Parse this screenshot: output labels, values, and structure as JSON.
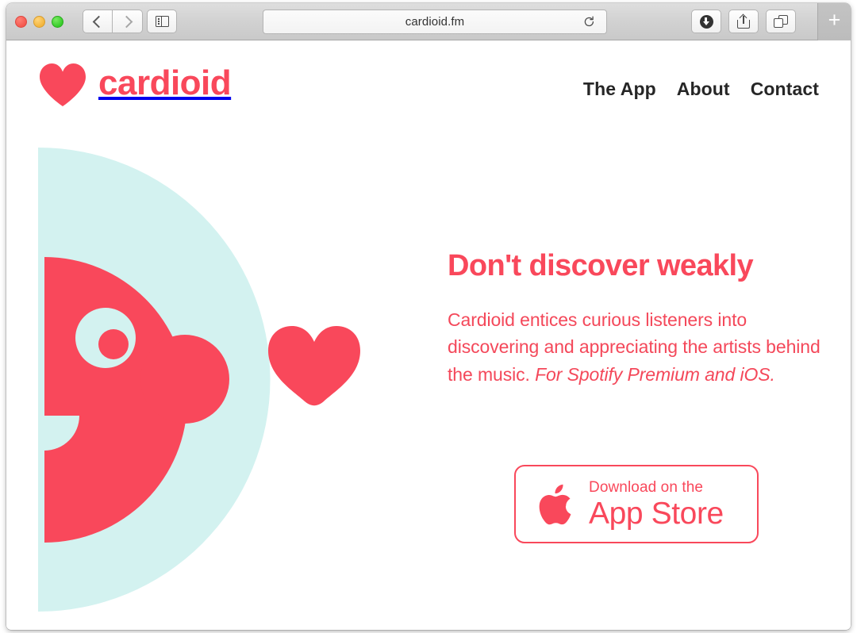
{
  "browser": {
    "window_controls": [
      "close",
      "minimize",
      "maximize"
    ],
    "back_label": "Back",
    "forward_label": "Forward",
    "sidebar_label": "Show Sidebar",
    "url": "cardioid.fm",
    "reload_label": "Reload",
    "downloads_label": "Downloads",
    "share_label": "Share",
    "tabs_label": "Show Tab Overview",
    "new_tab_label": "+"
  },
  "site": {
    "logo_text": "cardioid",
    "nav": [
      {
        "label": "The App"
      },
      {
        "label": "About"
      },
      {
        "label": "Contact"
      }
    ],
    "hero": {
      "title": "Don't discover weakly",
      "body_plain": "Cardioid entices curious listeners into discovering and appreciating the artists behind the music. ",
      "body_italic": "For Spotify Premium and iOS.",
      "appstore": {
        "small_label": "Download on the",
        "big_label": "App Store"
      }
    }
  },
  "colors": {
    "brand_pink": "#f9485b",
    "body_pink": "#f4485a",
    "mint": "#d3f2f0",
    "nav_dark": "#262626",
    "page_bg": "#ffffff",
    "toolbar_gray": "#d2d2d2"
  }
}
